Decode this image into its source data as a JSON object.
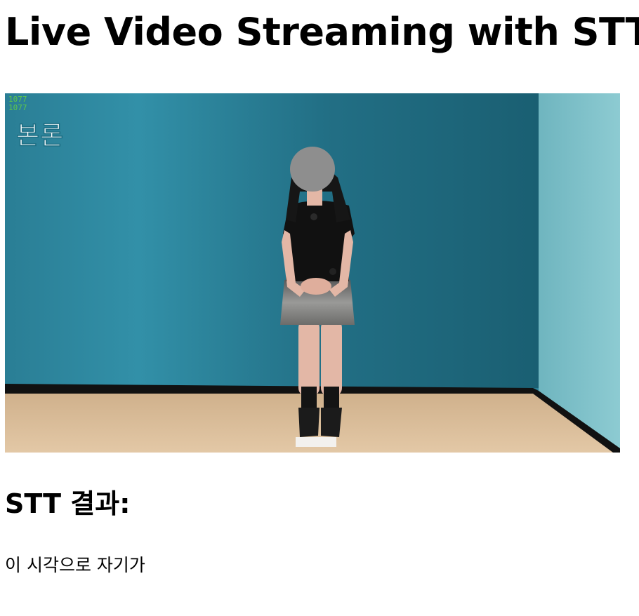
{
  "page": {
    "title": "Live Video Streaming with STT"
  },
  "video": {
    "frame_counter_line1": "1077",
    "frame_counter_line2": "1077",
    "phase_label": "본론"
  },
  "stt": {
    "heading": "STT 결과:",
    "result_text": "이 시각으로 자기가"
  },
  "colors": {
    "wall": "#2b7f95",
    "side_wall": "#7cc0c8",
    "floor": "#d9bc98",
    "counter_text": "#5fc84a"
  }
}
